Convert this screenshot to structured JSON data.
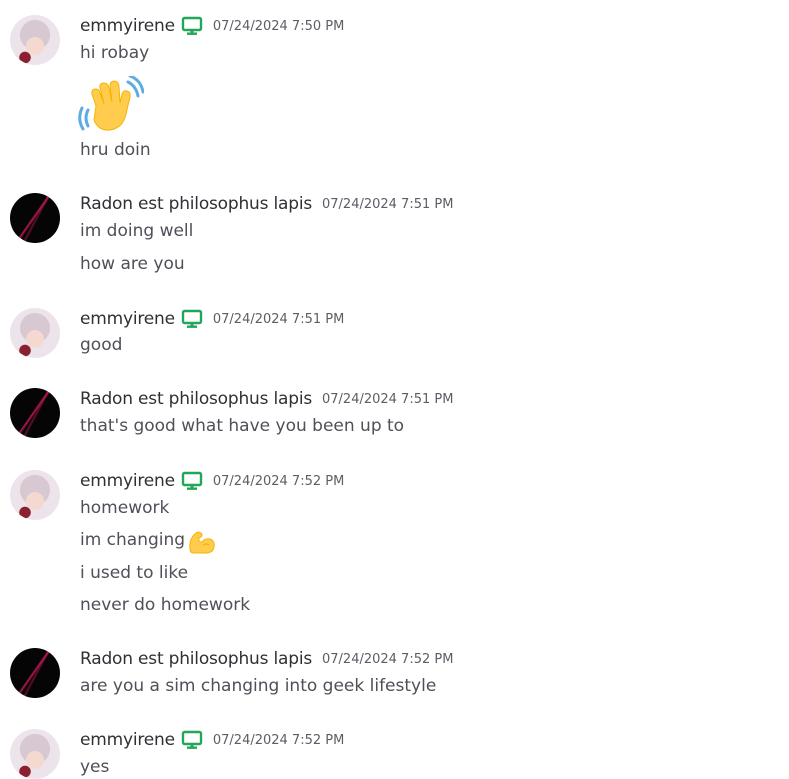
{
  "messages": [
    {
      "author": "emmyirene",
      "device_icon": "desktop-icon",
      "timestamp": "07/24/2024 7:50 PM",
      "lines": [
        "hi robay",
        "[wave-emoji]",
        "hru doin"
      ]
    },
    {
      "author": "Radon est philosophus lapis",
      "timestamp": "07/24/2024 7:51 PM",
      "lines": [
        "im doing well",
        "how are you"
      ]
    },
    {
      "author": "emmyirene",
      "device_icon": "desktop-icon",
      "timestamp": "07/24/2024 7:51 PM",
      "lines": [
        "good"
      ]
    },
    {
      "author": "Radon est philosophus lapis",
      "timestamp": "07/24/2024 7:51 PM",
      "lines": [
        "that's good what have you been up to"
      ]
    },
    {
      "author": "emmyirene",
      "device_icon": "desktop-icon",
      "timestamp": "07/24/2024 7:52 PM",
      "lines": [
        "homework",
        "im changing",
        "i used to like",
        "never do homework"
      ]
    },
    {
      "author": "Radon est philosophus lapis",
      "timestamp": "07/24/2024 7:52 PM",
      "lines": [
        "are you a sim changing into geek lifestyle"
      ]
    },
    {
      "author": "emmyirene",
      "device_icon": "desktop-icon",
      "timestamp": "07/24/2024 7:52 PM",
      "lines": [
        "yes"
      ]
    }
  ],
  "colors": {
    "device_icon": "#23a55a",
    "username": "#2e3035",
    "timestamp": "#5c5e66",
    "text": "#4e5058"
  }
}
